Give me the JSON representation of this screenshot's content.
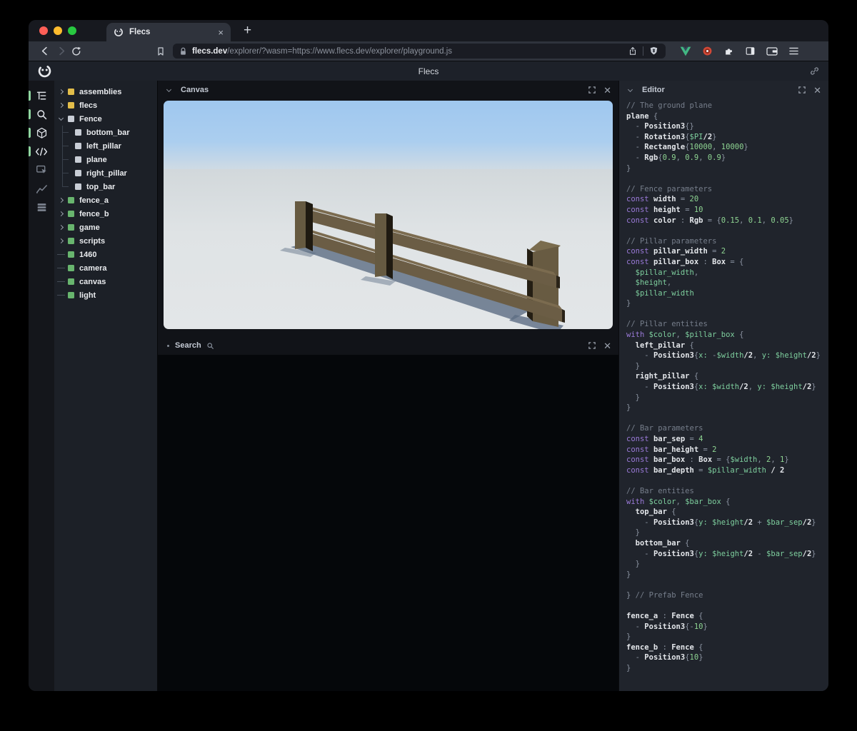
{
  "browser": {
    "tab": {
      "title": "Flecs",
      "close_label": "×"
    },
    "new_tab_label": "+",
    "url": {
      "domain": "flecs.dev",
      "path": "/explorer/?wasm=https://www.flecs.dev/explorer/playground.js"
    }
  },
  "app": {
    "title": "Flecs",
    "accent_green": "#68b56e",
    "sidebar_icons": [
      {
        "name": "entity-tree-icon",
        "active": true
      },
      {
        "name": "search-icon",
        "active": true
      },
      {
        "name": "canvas-3d-icon",
        "active": true
      },
      {
        "name": "code-editor-icon",
        "active": true
      },
      {
        "name": "inspector-icon",
        "active": false
      },
      {
        "name": "stats-chart-icon",
        "active": false
      },
      {
        "name": "queries-icon",
        "active": false
      }
    ],
    "tree": {
      "items": [
        {
          "label": "assemblies",
          "color": "yellow",
          "kind": "expand"
        },
        {
          "label": "flecs",
          "color": "yellow",
          "kind": "expand"
        },
        {
          "label": "Fence",
          "color": "gray",
          "kind": "expanded"
        },
        {
          "label": "bottom_bar",
          "color": "gray",
          "kind": "child"
        },
        {
          "label": "left_pillar",
          "color": "gray",
          "kind": "child"
        },
        {
          "label": "plane",
          "color": "gray",
          "kind": "child"
        },
        {
          "label": "right_pillar",
          "color": "gray",
          "kind": "child"
        },
        {
          "label": "top_bar",
          "color": "gray",
          "kind": "child-last"
        },
        {
          "label": "fence_a",
          "color": "green",
          "kind": "expand"
        },
        {
          "label": "fence_b",
          "color": "green",
          "kind": "expand"
        },
        {
          "label": "game",
          "color": "green",
          "kind": "expand"
        },
        {
          "label": "scripts",
          "color": "green",
          "kind": "expand"
        },
        {
          "label": "1460",
          "color": "green",
          "kind": "leaf"
        },
        {
          "label": "camera",
          "color": "green",
          "kind": "leaf"
        },
        {
          "label": "canvas",
          "color": "green",
          "kind": "leaf"
        },
        {
          "label": "light",
          "color": "green",
          "kind": "leaf"
        }
      ]
    },
    "panels": {
      "canvas": {
        "title": "Canvas"
      },
      "search": {
        "title": "Search"
      },
      "editor": {
        "title": "Editor"
      }
    }
  },
  "scene": {
    "sky_color": "#a3cbf1",
    "ground_color": "#e2e5e7",
    "fence_color": "#6b5d45",
    "shadow_color": "#5c6d83"
  },
  "editor_code": {
    "lines": [
      [
        [
          "cm",
          "// The ground plane"
        ]
      ],
      [
        [
          "id",
          "plane"
        ],
        [
          "pu",
          " {"
        ]
      ],
      [
        [
          "pu",
          "  - "
        ],
        [
          "id",
          "Position3"
        ],
        [
          "pu",
          "{}"
        ]
      ],
      [
        [
          "pu",
          "  - "
        ],
        [
          "id",
          "Rotation3"
        ],
        [
          "pu",
          "{"
        ],
        [
          "vr",
          "$PI"
        ],
        [
          "id",
          "/2"
        ],
        [
          "pu",
          "}"
        ]
      ],
      [
        [
          "pu",
          "  - "
        ],
        [
          "id",
          "Rectangle"
        ],
        [
          "pu",
          "{"
        ],
        [
          "nu",
          "10000"
        ],
        [
          "pu",
          ", "
        ],
        [
          "nu",
          "10000"
        ],
        [
          "pu",
          "}"
        ]
      ],
      [
        [
          "pu",
          "  - "
        ],
        [
          "id",
          "Rgb"
        ],
        [
          "pu",
          "{"
        ],
        [
          "nu",
          "0.9"
        ],
        [
          "pu",
          ", "
        ],
        [
          "nu",
          "0.9"
        ],
        [
          "pu",
          ", "
        ],
        [
          "nu",
          "0.9"
        ],
        [
          "pu",
          "}"
        ]
      ],
      [
        [
          "pu",
          "}"
        ]
      ],
      [],
      [
        [
          "cm",
          "// Fence parameters"
        ]
      ],
      [
        [
          "kw",
          "const "
        ],
        [
          "id",
          "width"
        ],
        [
          "pu",
          " = "
        ],
        [
          "nu",
          "20"
        ]
      ],
      [
        [
          "kw",
          "const "
        ],
        [
          "id",
          "height"
        ],
        [
          "pu",
          " = "
        ],
        [
          "nu",
          "10"
        ]
      ],
      [
        [
          "kw",
          "const "
        ],
        [
          "id",
          "color"
        ],
        [
          "pu",
          " : "
        ],
        [
          "id",
          "Rgb"
        ],
        [
          "pu",
          " = {"
        ],
        [
          "nu",
          "0.15"
        ],
        [
          "pu",
          ", "
        ],
        [
          "nu",
          "0.1"
        ],
        [
          "pu",
          ", "
        ],
        [
          "nu",
          "0.05"
        ],
        [
          "pu",
          "}"
        ]
      ],
      [],
      [
        [
          "cm",
          "// Pillar parameters"
        ]
      ],
      [
        [
          "kw",
          "const "
        ],
        [
          "id",
          "pillar_width"
        ],
        [
          "pu",
          " = "
        ],
        [
          "nu",
          "2"
        ]
      ],
      [
        [
          "kw",
          "const "
        ],
        [
          "id",
          "pillar_box"
        ],
        [
          "pu",
          " : "
        ],
        [
          "id",
          "Box"
        ],
        [
          "pu",
          " = {"
        ]
      ],
      [
        [
          "vr",
          "  $pillar_width"
        ],
        [
          "pu",
          ","
        ]
      ],
      [
        [
          "vr",
          "  $height"
        ],
        [
          "pu",
          ","
        ]
      ],
      [
        [
          "vr",
          "  $pillar_width"
        ]
      ],
      [
        [
          "pu",
          "}"
        ]
      ],
      [],
      [
        [
          "cm",
          "// Pillar entities"
        ]
      ],
      [
        [
          "kw",
          "with "
        ],
        [
          "vr",
          "$color"
        ],
        [
          "pu",
          ", "
        ],
        [
          "vr",
          "$pillar_box"
        ],
        [
          "pu",
          " {"
        ]
      ],
      [
        [
          "id",
          "  left_pillar"
        ],
        [
          "pu",
          " {"
        ]
      ],
      [
        [
          "pu",
          "    - "
        ],
        [
          "id",
          "Position3"
        ],
        [
          "pu",
          "{"
        ],
        [
          "vr",
          "x:"
        ],
        [
          "pu",
          " -"
        ],
        [
          "vr",
          "$width"
        ],
        [
          "id",
          "/2"
        ],
        [
          "pu",
          ", "
        ],
        [
          "vr",
          "y:"
        ],
        [
          "pu",
          " "
        ],
        [
          "vr",
          "$height"
        ],
        [
          "id",
          "/2"
        ],
        [
          "pu",
          "}"
        ]
      ],
      [
        [
          "pu",
          "  }"
        ]
      ],
      [
        [
          "id",
          "  right_pillar"
        ],
        [
          "pu",
          " {"
        ]
      ],
      [
        [
          "pu",
          "    - "
        ],
        [
          "id",
          "Position3"
        ],
        [
          "pu",
          "{"
        ],
        [
          "vr",
          "x:"
        ],
        [
          "pu",
          " "
        ],
        [
          "vr",
          "$width"
        ],
        [
          "id",
          "/2"
        ],
        [
          "pu",
          ", "
        ],
        [
          "vr",
          "y:"
        ],
        [
          "pu",
          " "
        ],
        [
          "vr",
          "$height"
        ],
        [
          "id",
          "/2"
        ],
        [
          "pu",
          "}"
        ]
      ],
      [
        [
          "pu",
          "  }"
        ]
      ],
      [
        [
          "pu",
          "}"
        ]
      ],
      [],
      [
        [
          "cm",
          "// Bar parameters"
        ]
      ],
      [
        [
          "kw",
          "const "
        ],
        [
          "id",
          "bar_sep"
        ],
        [
          "pu",
          " = "
        ],
        [
          "nu",
          "4"
        ]
      ],
      [
        [
          "kw",
          "const "
        ],
        [
          "id",
          "bar_height"
        ],
        [
          "pu",
          " = "
        ],
        [
          "nu",
          "2"
        ]
      ],
      [
        [
          "kw",
          "const "
        ],
        [
          "id",
          "bar_box"
        ],
        [
          "pu",
          " : "
        ],
        [
          "id",
          "Box"
        ],
        [
          "pu",
          " = {"
        ],
        [
          "vr",
          "$width"
        ],
        [
          "pu",
          ", "
        ],
        [
          "nu",
          "2"
        ],
        [
          "pu",
          ", "
        ],
        [
          "nu",
          "1"
        ],
        [
          "pu",
          "}"
        ]
      ],
      [
        [
          "kw",
          "const "
        ],
        [
          "id",
          "bar_depth"
        ],
        [
          "pu",
          " = "
        ],
        [
          "vr",
          "$pillar_width"
        ],
        [
          "id",
          " / 2"
        ]
      ],
      [],
      [
        [
          "cm",
          "// Bar entities"
        ]
      ],
      [
        [
          "kw",
          "with "
        ],
        [
          "vr",
          "$color"
        ],
        [
          "pu",
          ", "
        ],
        [
          "vr",
          "$bar_box"
        ],
        [
          "pu",
          " {"
        ]
      ],
      [
        [
          "id",
          "  top_bar"
        ],
        [
          "pu",
          " {"
        ]
      ],
      [
        [
          "pu",
          "    - "
        ],
        [
          "id",
          "Position3"
        ],
        [
          "pu",
          "{"
        ],
        [
          "vr",
          "y:"
        ],
        [
          "pu",
          " "
        ],
        [
          "vr",
          "$height"
        ],
        [
          "id",
          "/2"
        ],
        [
          "pu",
          " + "
        ],
        [
          "vr",
          "$bar_sep"
        ],
        [
          "id",
          "/2"
        ],
        [
          "pu",
          "}"
        ]
      ],
      [
        [
          "pu",
          "  }"
        ]
      ],
      [
        [
          "id",
          "  bottom_bar"
        ],
        [
          "pu",
          " {"
        ]
      ],
      [
        [
          "pu",
          "    - "
        ],
        [
          "id",
          "Position3"
        ],
        [
          "pu",
          "{"
        ],
        [
          "vr",
          "y:"
        ],
        [
          "pu",
          " "
        ],
        [
          "vr",
          "$height"
        ],
        [
          "id",
          "/2"
        ],
        [
          "pu",
          " - "
        ],
        [
          "vr",
          "$bar_sep"
        ],
        [
          "id",
          "/2"
        ],
        [
          "pu",
          "}"
        ]
      ],
      [
        [
          "pu",
          "  }"
        ]
      ],
      [
        [
          "pu",
          "}"
        ]
      ],
      [],
      [
        [
          "pu",
          "} "
        ],
        [
          "cm",
          "// Prefab Fence"
        ]
      ],
      [],
      [
        [
          "id",
          "fence_a"
        ],
        [
          "pu",
          " : "
        ],
        [
          "id",
          "Fence"
        ],
        [
          "pu",
          " {"
        ]
      ],
      [
        [
          "pu",
          "  - "
        ],
        [
          "id",
          "Position3"
        ],
        [
          "pu",
          "{-"
        ],
        [
          "nu",
          "10"
        ],
        [
          "pu",
          "}"
        ]
      ],
      [
        [
          "pu",
          "}"
        ]
      ],
      [
        [
          "id",
          "fence_b"
        ],
        [
          "pu",
          " : "
        ],
        [
          "id",
          "Fence"
        ],
        [
          "pu",
          " {"
        ]
      ],
      [
        [
          "pu",
          "  - "
        ],
        [
          "id",
          "Position3"
        ],
        [
          "pu",
          "{"
        ],
        [
          "nu",
          "10"
        ],
        [
          "pu",
          "}"
        ]
      ],
      [
        [
          "pu",
          "}"
        ]
      ]
    ]
  }
}
